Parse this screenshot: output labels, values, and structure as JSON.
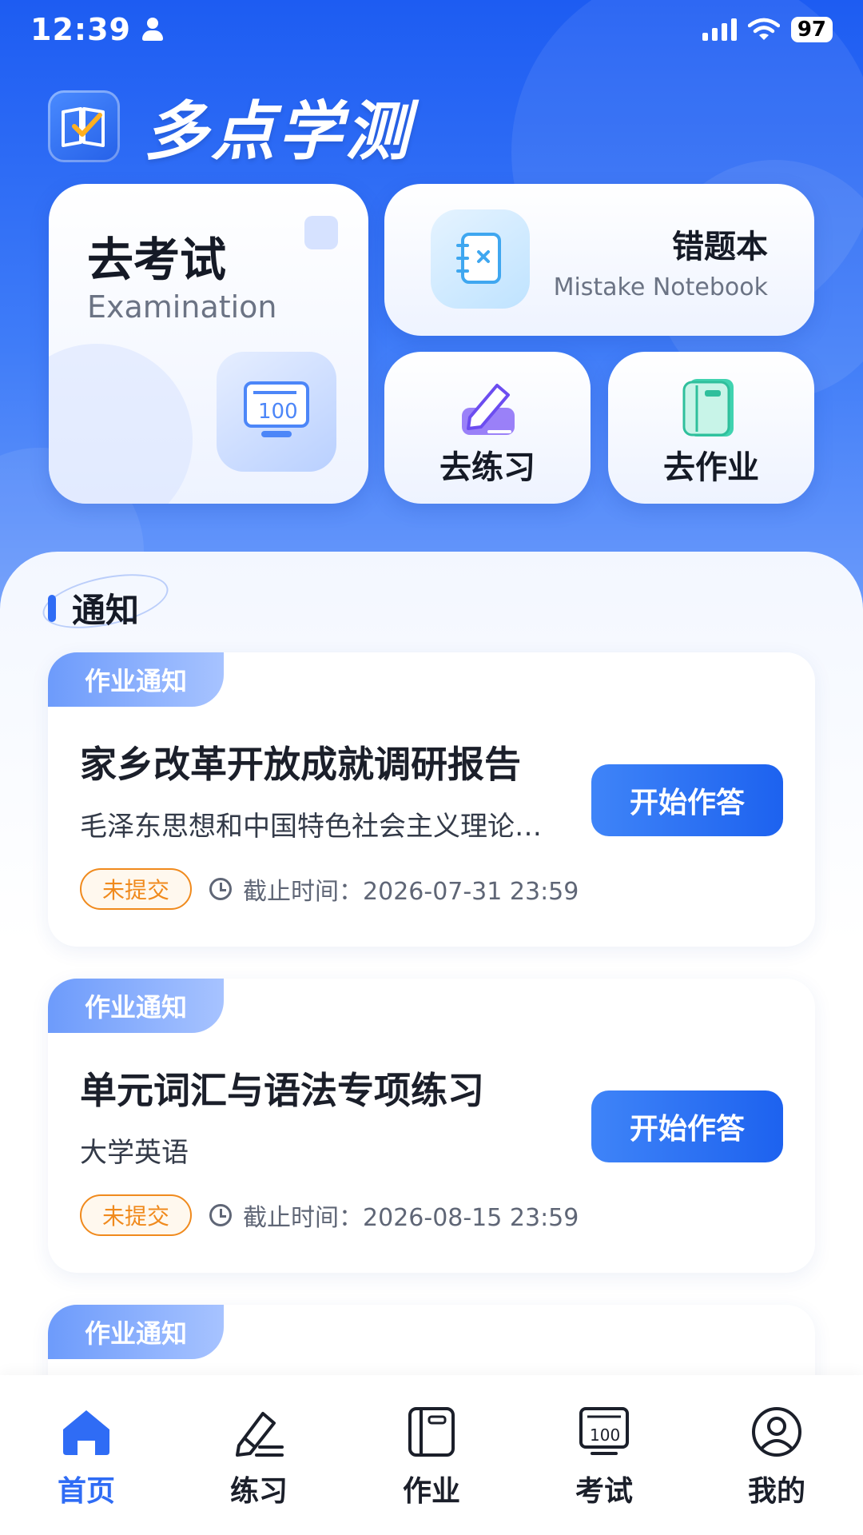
{
  "status_bar": {
    "time": "12:39",
    "battery": "97"
  },
  "app": {
    "title": "多点学测"
  },
  "features": {
    "exam": {
      "title": "去考试",
      "subtitle": "Examination"
    },
    "mistake": {
      "title": "错题本",
      "subtitle": "Mistake Notebook"
    },
    "practice": {
      "title": "去练习"
    },
    "homework": {
      "title": "去作业"
    }
  },
  "notices_section": {
    "title": "通知"
  },
  "notices": [
    {
      "tag": "作业通知",
      "title": "家乡改革开放成就调研报告",
      "course": "毛泽东思想和中国特色社会主义理论体系概论",
      "status": "未提交",
      "deadline": "截止时间：2026-07-31 23:59",
      "action": "开始作答"
    },
    {
      "tag": "作业通知",
      "title": "单元词汇与语法专项练习",
      "course": "大学英语",
      "status": "未提交",
      "deadline": "截止时间：2026-08-15 23:59",
      "action": "开始作答"
    },
    {
      "tag": "作业通知"
    }
  ],
  "nav": [
    {
      "label": "首页",
      "icon": "home-icon",
      "active": true
    },
    {
      "label": "练习",
      "icon": "pencil-icon"
    },
    {
      "label": "作业",
      "icon": "notebook-icon"
    },
    {
      "label": "考试",
      "icon": "exam-board-icon"
    },
    {
      "label": "我的",
      "icon": "user-icon"
    }
  ],
  "colors": {
    "primary": "#2f6cf5",
    "warning": "#f08a1d"
  }
}
